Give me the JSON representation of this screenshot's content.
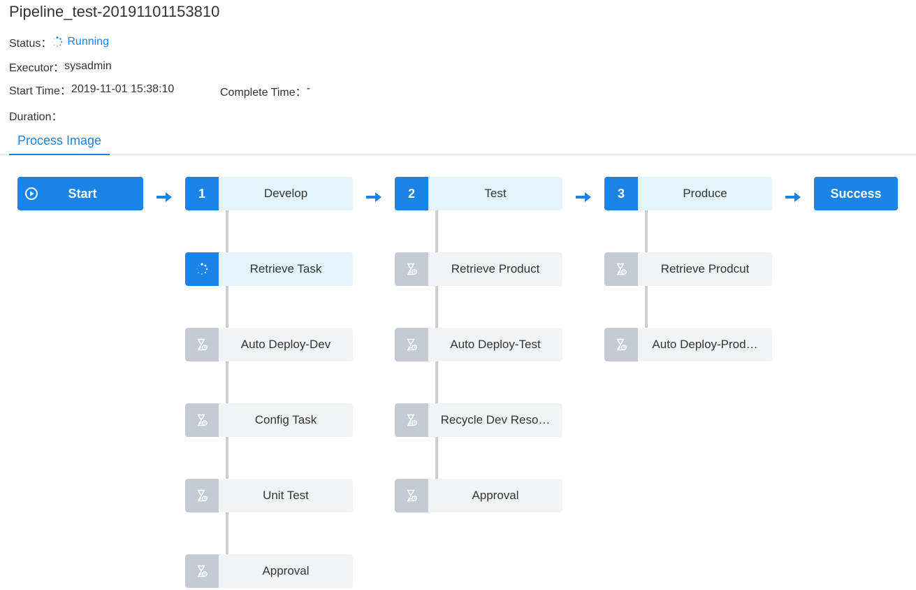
{
  "header": {
    "title": "Pipeline_test-20191101153810",
    "status_label": "Status：",
    "status_value": "Running",
    "executor_label": "Executor：",
    "executor_value": "sysadmin",
    "start_time_label": "Start Time：",
    "start_time_value": "2019-11-01 15:38:10",
    "complete_time_label": "Complete Time：",
    "complete_time_value": "-",
    "duration_label": "Duration：",
    "duration_value": ""
  },
  "tabs": [
    {
      "label": "Process Image",
      "active": true
    }
  ],
  "flow": {
    "start_label": "Start",
    "success_label": "Success",
    "stages": [
      {
        "number": "1",
        "name": "Develop",
        "tasks": [
          {
            "name": "Retrieve Task",
            "state": "running",
            "icon": "spinner-icon"
          },
          {
            "name": "Auto Deploy-Dev",
            "state": "pending",
            "icon": "hourglass-icon"
          },
          {
            "name": "Config Task",
            "state": "pending",
            "icon": "hourglass-icon"
          },
          {
            "name": "Unit Test",
            "state": "pending",
            "icon": "hourglass-icon"
          },
          {
            "name": "Approval",
            "state": "pending",
            "icon": "hourglass-icon"
          }
        ]
      },
      {
        "number": "2",
        "name": "Test",
        "tasks": [
          {
            "name": "Retrieve Product",
            "state": "pending",
            "icon": "hourglass-icon"
          },
          {
            "name": "Auto Deploy-Test",
            "state": "pending",
            "icon": "hourglass-icon"
          },
          {
            "name": "Recycle Dev Reso…",
            "state": "pending",
            "icon": "hourglass-icon"
          },
          {
            "name": "Approval",
            "state": "pending",
            "icon": "hourglass-icon"
          }
        ]
      },
      {
        "number": "3",
        "name": "Produce",
        "tasks": [
          {
            "name": "Retrieve Prodcut",
            "state": "pending",
            "icon": "hourglass-icon"
          },
          {
            "name": "Auto Deploy-Prod…",
            "state": "pending",
            "icon": "hourglass-icon"
          }
        ]
      }
    ]
  },
  "colors": {
    "accent": "#1b82e6",
    "stage_bg": "#e3f4fd",
    "pending_badge": "#c3cad3",
    "pending_bg": "#f2f3f5",
    "connector": "#cfcfcf"
  }
}
